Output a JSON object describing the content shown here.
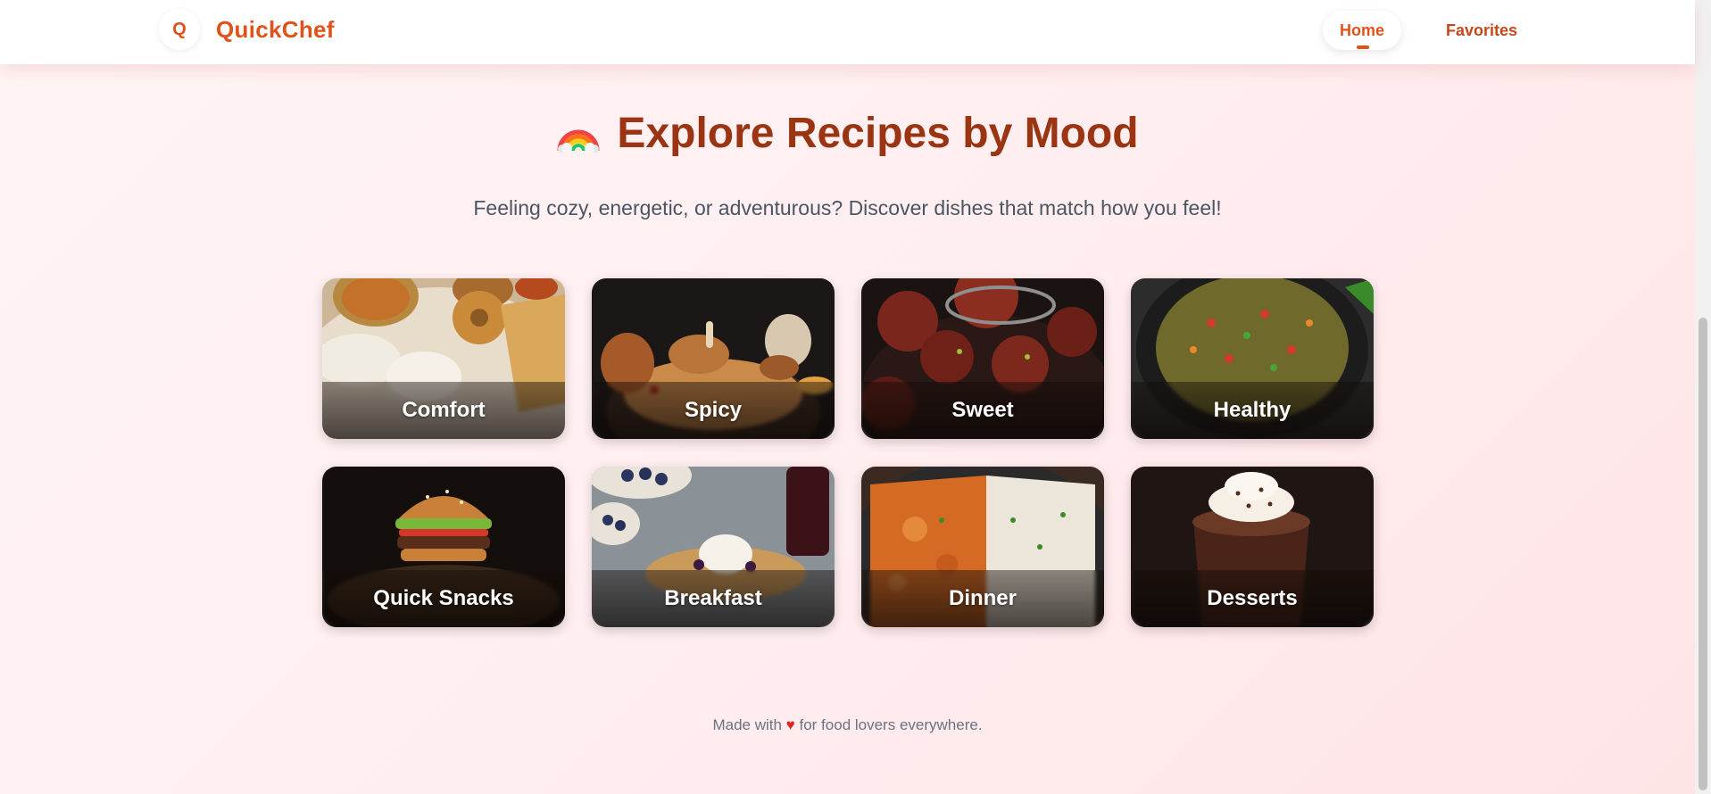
{
  "brand": {
    "logo_letter": "Q",
    "name": "QuickChef",
    "color": "#e0521a"
  },
  "nav": {
    "home": "Home",
    "favorites": "Favorites",
    "active": "Home"
  },
  "hero": {
    "title": "Explore Recipes by Mood",
    "subtitle": "Feeling cozy, energetic, or adventurous? Discover dishes that match how you feel!"
  },
  "moods": [
    {
      "label": "Comfort",
      "icon": "idli-vada-dosa-plate"
    },
    {
      "label": "Spicy",
      "icon": "chicken-biryani-bowl"
    },
    {
      "label": "Sweet",
      "icon": "gulab-jamun"
    },
    {
      "label": "Healthy",
      "icon": "sprouts-salad"
    },
    {
      "label": "Quick Snacks",
      "icon": "burger"
    },
    {
      "label": "Breakfast",
      "icon": "blueberry-pancakes"
    },
    {
      "label": "Dinner",
      "icon": "butter-chicken-rice"
    },
    {
      "label": "Desserts",
      "icon": "chocolate-mousse"
    }
  ],
  "footer": {
    "before": "Made with",
    "heart": "♥",
    "after": "for food lovers everywhere."
  }
}
